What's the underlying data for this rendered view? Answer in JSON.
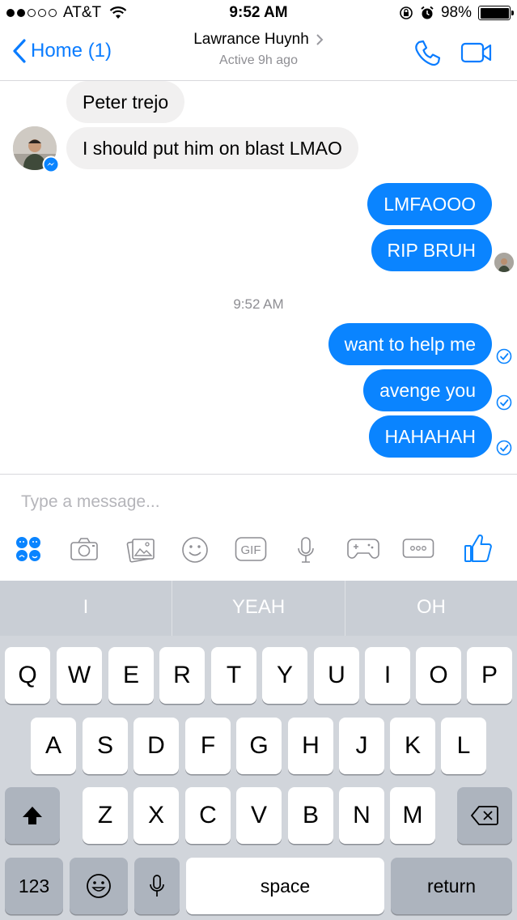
{
  "status_bar": {
    "carrier": "AT&T",
    "time": "9:52 AM",
    "battery": "98%"
  },
  "nav": {
    "back_label": "Home (1)",
    "contact_name": "Lawrance Huynh",
    "active_status": "Active 9h ago"
  },
  "messages": [
    {
      "text": "Peter trejo",
      "from": "them"
    },
    {
      "text": "I should put him on blast LMAO",
      "from": "them"
    },
    {
      "text": "LMFAOOO",
      "from": "me"
    },
    {
      "text": "RIP BRUH",
      "from": "me"
    },
    {
      "text": "want to help me",
      "from": "me",
      "status": "sent"
    },
    {
      "text": "avenge you",
      "from": "me",
      "status": "sent"
    },
    {
      "text": "HAHAHAH",
      "from": "me",
      "status": "sent"
    }
  ],
  "timestamp": "9:52 AM",
  "composer": {
    "placeholder": "Type a message..."
  },
  "toolbar_icons": [
    "emoji-grid-icon",
    "camera-icon",
    "photo-icon",
    "smiley-icon",
    "gif-icon",
    "microphone-icon",
    "game-icon",
    "more-icon",
    "like-icon"
  ],
  "keyboard": {
    "predictions": [
      "I",
      "YEAH",
      "OH"
    ],
    "row1": [
      "Q",
      "W",
      "E",
      "R",
      "T",
      "Y",
      "U",
      "I",
      "O",
      "P"
    ],
    "row2": [
      "A",
      "S",
      "D",
      "F",
      "G",
      "H",
      "J",
      "K",
      "L"
    ],
    "row3": [
      "Z",
      "X",
      "C",
      "V",
      "B",
      "N",
      "M"
    ],
    "numbers_label": "123",
    "space_label": "space",
    "return_label": "return"
  },
  "colors": {
    "accent": "#0a84ff",
    "incoming_bubble": "#f1f0f0",
    "keyboard_bg": "#d1d5db"
  }
}
